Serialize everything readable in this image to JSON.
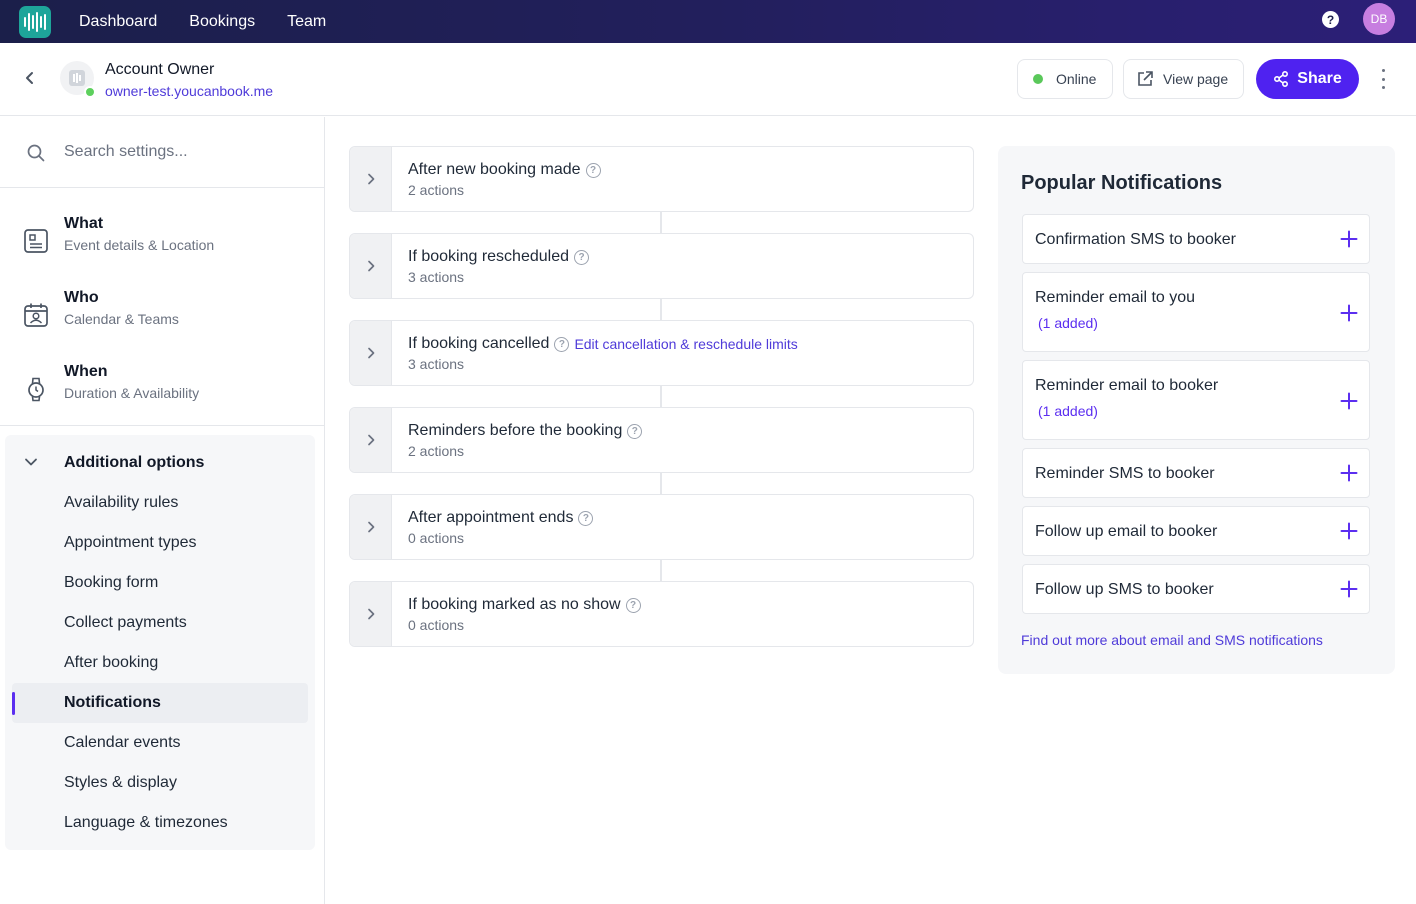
{
  "topnav": {
    "items": [
      "Dashboard",
      "Bookings",
      "Team"
    ],
    "help_label": "?",
    "avatar_initials": "DB"
  },
  "header": {
    "account_name": "Account Owner",
    "account_url": "owner-test.youcanbook.me",
    "online_label": "Online",
    "view_page_label": "View page",
    "share_label": "Share"
  },
  "sidebar": {
    "search_placeholder": "Search settings...",
    "sections": [
      {
        "title": "What",
        "subtitle": "Event details & Location",
        "icon": "document-icon"
      },
      {
        "title": "Who",
        "subtitle": "Calendar & Teams",
        "icon": "user-calendar-icon"
      },
      {
        "title": "When",
        "subtitle": "Duration & Availability",
        "icon": "watch-icon"
      }
    ],
    "additional_label": "Additional options",
    "additional_items": [
      "Availability rules",
      "Appointment types",
      "Booking form",
      "Collect payments",
      "After booking",
      "Notifications",
      "Calendar events",
      "Styles & display",
      "Language & timezones"
    ],
    "active_item": "Notifications"
  },
  "flow": {
    "cards": [
      {
        "title": "After new booking made",
        "actions": "2 actions"
      },
      {
        "title": "If booking rescheduled",
        "actions": "3 actions"
      },
      {
        "title": "If booking cancelled",
        "actions": "3 actions",
        "link": "Edit cancellation & reschedule limits"
      },
      {
        "title": "Reminders before the booking",
        "actions": "2 actions"
      },
      {
        "title": "After appointment ends",
        "actions": "0 actions"
      },
      {
        "title": "If booking marked as no show",
        "actions": "0 actions"
      }
    ]
  },
  "popular": {
    "title": "Popular Notifications",
    "items": [
      {
        "label": "Confirmation SMS to booker",
        "added": ""
      },
      {
        "label": "Reminder email to you",
        "added": "(1 added)"
      },
      {
        "label": "Reminder email to booker",
        "added": "(1 added)"
      },
      {
        "label": "Reminder SMS to booker",
        "added": ""
      },
      {
        "label": "Follow up email to booker",
        "added": ""
      },
      {
        "label": "Follow up SMS to booker",
        "added": ""
      }
    ],
    "footer_link": "Find out more about email and SMS notifications"
  },
  "colors": {
    "accent": "#4f22f0",
    "link": "#4f3bd9",
    "online": "#5ac85a",
    "logo": "#1ea59a"
  }
}
